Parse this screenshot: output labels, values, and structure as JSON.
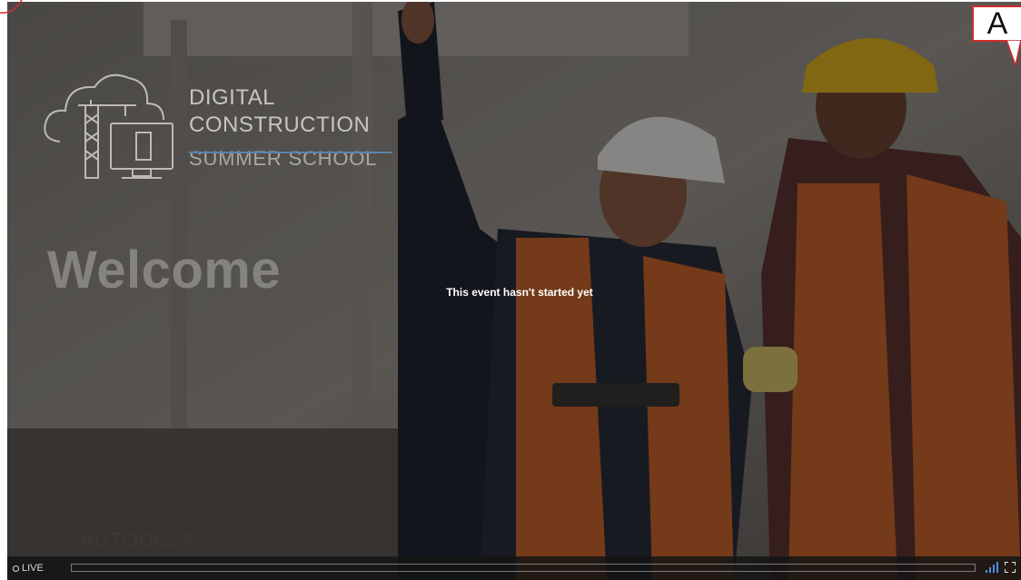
{
  "slide": {
    "logo": {
      "line1": "DIGITAL",
      "line2": "CONSTRUCTION",
      "line3": "SUMMER SCHOOL"
    },
    "welcome": "Welcome",
    "brand": "AUTODESK"
  },
  "status_message": "This event hasn't started yet",
  "controls": {
    "live_label": "LIVE",
    "signal_icon": "signal-strength-icon",
    "fullscreen_icon": "fullscreen-icon"
  },
  "annotation": {
    "badge_label": "A",
    "accent_color": "#d12c2c"
  }
}
